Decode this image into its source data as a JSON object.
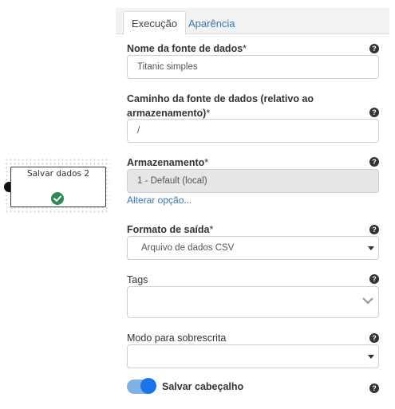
{
  "node": {
    "title": "Salvar dados 2",
    "status_icon": "check-circle-icon"
  },
  "tabs": [
    {
      "label": "Execução",
      "active": true
    },
    {
      "label": "Aparência",
      "active": false
    }
  ],
  "form": {
    "name": {
      "label": "Nome da fonte de dados",
      "required": "*",
      "value": "Titanic simples"
    },
    "path": {
      "label_line1": "Caminho da fonte de dados (relativo ao",
      "label_line2": "armazenamento)",
      "required": "*",
      "value": "/"
    },
    "storage": {
      "label": "Armazenamento",
      "required": "*",
      "value": "1 - Default (local)",
      "change_link": "Alterar opção..."
    },
    "format": {
      "label": "Formato de saída",
      "required": "*",
      "value": "Arquivo de dados CSV"
    },
    "tags": {
      "label": "Tags",
      "value": ""
    },
    "overwrite": {
      "label": "Modo para sobrescrita",
      "value": ""
    },
    "header_toggle": {
      "label": "Salvar cabeçalho",
      "on": true
    }
  },
  "colors": {
    "accent": "#337ab7",
    "toggle": "#1a73e8",
    "success": "#2e8b57"
  }
}
